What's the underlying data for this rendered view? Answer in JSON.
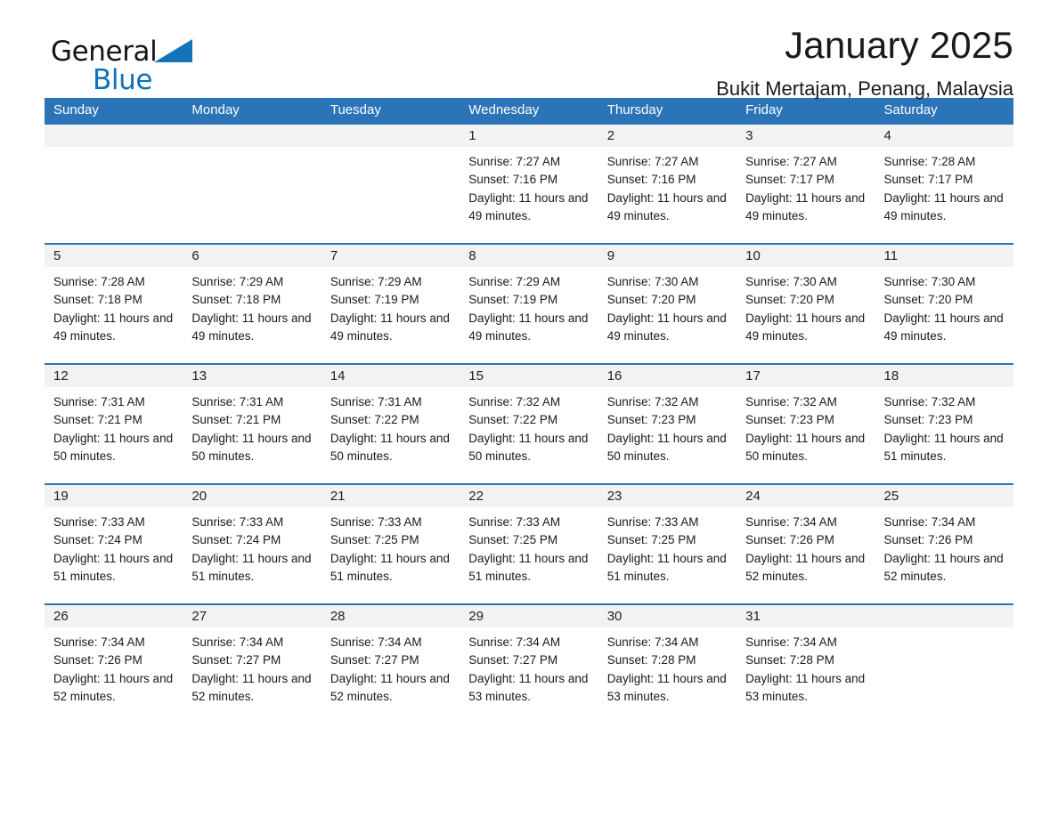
{
  "brand": {
    "name_part1": "General",
    "name_part2": "Blue",
    "triangle_color": "#1573ba",
    "blue_color": "#0f72bb"
  },
  "header": {
    "title": "January 2025",
    "subtitle": "Bukit Mertajam, Penang, Malaysia"
  },
  "theme": {
    "header_blue": "#2b74b8",
    "day_band_gray": "#f2f2f2",
    "text_color": "#1a1a1a"
  },
  "weekdays": [
    "Sunday",
    "Monday",
    "Tuesday",
    "Wednesday",
    "Thursday",
    "Friday",
    "Saturday"
  ],
  "weeks": [
    [
      {
        "day": "",
        "sunrise": "",
        "sunset": "",
        "daylight": ""
      },
      {
        "day": "",
        "sunrise": "",
        "sunset": "",
        "daylight": ""
      },
      {
        "day": "",
        "sunrise": "",
        "sunset": "",
        "daylight": ""
      },
      {
        "day": "1",
        "sunrise": "Sunrise: 7:27 AM",
        "sunset": "Sunset: 7:16 PM",
        "daylight": "Daylight: 11 hours and 49 minutes."
      },
      {
        "day": "2",
        "sunrise": "Sunrise: 7:27 AM",
        "sunset": "Sunset: 7:16 PM",
        "daylight": "Daylight: 11 hours and 49 minutes."
      },
      {
        "day": "3",
        "sunrise": "Sunrise: 7:27 AM",
        "sunset": "Sunset: 7:17 PM",
        "daylight": "Daylight: 11 hours and 49 minutes."
      },
      {
        "day": "4",
        "sunrise": "Sunrise: 7:28 AM",
        "sunset": "Sunset: 7:17 PM",
        "daylight": "Daylight: 11 hours and 49 minutes."
      }
    ],
    [
      {
        "day": "5",
        "sunrise": "Sunrise: 7:28 AM",
        "sunset": "Sunset: 7:18 PM",
        "daylight": "Daylight: 11 hours and 49 minutes."
      },
      {
        "day": "6",
        "sunrise": "Sunrise: 7:29 AM",
        "sunset": "Sunset: 7:18 PM",
        "daylight": "Daylight: 11 hours and 49 minutes."
      },
      {
        "day": "7",
        "sunrise": "Sunrise: 7:29 AM",
        "sunset": "Sunset: 7:19 PM",
        "daylight": "Daylight: 11 hours and 49 minutes."
      },
      {
        "day": "8",
        "sunrise": "Sunrise: 7:29 AM",
        "sunset": "Sunset: 7:19 PM",
        "daylight": "Daylight: 11 hours and 49 minutes."
      },
      {
        "day": "9",
        "sunrise": "Sunrise: 7:30 AM",
        "sunset": "Sunset: 7:20 PM",
        "daylight": "Daylight: 11 hours and 49 minutes."
      },
      {
        "day": "10",
        "sunrise": "Sunrise: 7:30 AM",
        "sunset": "Sunset: 7:20 PM",
        "daylight": "Daylight: 11 hours and 49 minutes."
      },
      {
        "day": "11",
        "sunrise": "Sunrise: 7:30 AM",
        "sunset": "Sunset: 7:20 PM",
        "daylight": "Daylight: 11 hours and 49 minutes."
      }
    ],
    [
      {
        "day": "12",
        "sunrise": "Sunrise: 7:31 AM",
        "sunset": "Sunset: 7:21 PM",
        "daylight": "Daylight: 11 hours and 50 minutes."
      },
      {
        "day": "13",
        "sunrise": "Sunrise: 7:31 AM",
        "sunset": "Sunset: 7:21 PM",
        "daylight": "Daylight: 11 hours and 50 minutes."
      },
      {
        "day": "14",
        "sunrise": "Sunrise: 7:31 AM",
        "sunset": "Sunset: 7:22 PM",
        "daylight": "Daylight: 11 hours and 50 minutes."
      },
      {
        "day": "15",
        "sunrise": "Sunrise: 7:32 AM",
        "sunset": "Sunset: 7:22 PM",
        "daylight": "Daylight: 11 hours and 50 minutes."
      },
      {
        "day": "16",
        "sunrise": "Sunrise: 7:32 AM",
        "sunset": "Sunset: 7:23 PM",
        "daylight": "Daylight: 11 hours and 50 minutes."
      },
      {
        "day": "17",
        "sunrise": "Sunrise: 7:32 AM",
        "sunset": "Sunset: 7:23 PM",
        "daylight": "Daylight: 11 hours and 50 minutes."
      },
      {
        "day": "18",
        "sunrise": "Sunrise: 7:32 AM",
        "sunset": "Sunset: 7:23 PM",
        "daylight": "Daylight: 11 hours and 51 minutes."
      }
    ],
    [
      {
        "day": "19",
        "sunrise": "Sunrise: 7:33 AM",
        "sunset": "Sunset: 7:24 PM",
        "daylight": "Daylight: 11 hours and 51 minutes."
      },
      {
        "day": "20",
        "sunrise": "Sunrise: 7:33 AM",
        "sunset": "Sunset: 7:24 PM",
        "daylight": "Daylight: 11 hours and 51 minutes."
      },
      {
        "day": "21",
        "sunrise": "Sunrise: 7:33 AM",
        "sunset": "Sunset: 7:25 PM",
        "daylight": "Daylight: 11 hours and 51 minutes."
      },
      {
        "day": "22",
        "sunrise": "Sunrise: 7:33 AM",
        "sunset": "Sunset: 7:25 PM",
        "daylight": "Daylight: 11 hours and 51 minutes."
      },
      {
        "day": "23",
        "sunrise": "Sunrise: 7:33 AM",
        "sunset": "Sunset: 7:25 PM",
        "daylight": "Daylight: 11 hours and 51 minutes."
      },
      {
        "day": "24",
        "sunrise": "Sunrise: 7:34 AM",
        "sunset": "Sunset: 7:26 PM",
        "daylight": "Daylight: 11 hours and 52 minutes."
      },
      {
        "day": "25",
        "sunrise": "Sunrise: 7:34 AM",
        "sunset": "Sunset: 7:26 PM",
        "daylight": "Daylight: 11 hours and 52 minutes."
      }
    ],
    [
      {
        "day": "26",
        "sunrise": "Sunrise: 7:34 AM",
        "sunset": "Sunset: 7:26 PM",
        "daylight": "Daylight: 11 hours and 52 minutes."
      },
      {
        "day": "27",
        "sunrise": "Sunrise: 7:34 AM",
        "sunset": "Sunset: 7:27 PM",
        "daylight": "Daylight: 11 hours and 52 minutes."
      },
      {
        "day": "28",
        "sunrise": "Sunrise: 7:34 AM",
        "sunset": "Sunset: 7:27 PM",
        "daylight": "Daylight: 11 hours and 52 minutes."
      },
      {
        "day": "29",
        "sunrise": "Sunrise: 7:34 AM",
        "sunset": "Sunset: 7:27 PM",
        "daylight": "Daylight: 11 hours and 53 minutes."
      },
      {
        "day": "30",
        "sunrise": "Sunrise: 7:34 AM",
        "sunset": "Sunset: 7:28 PM",
        "daylight": "Daylight: 11 hours and 53 minutes."
      },
      {
        "day": "31",
        "sunrise": "Sunrise: 7:34 AM",
        "sunset": "Sunset: 7:28 PM",
        "daylight": "Daylight: 11 hours and 53 minutes."
      },
      {
        "day": "",
        "sunrise": "",
        "sunset": "",
        "daylight": ""
      }
    ]
  ]
}
